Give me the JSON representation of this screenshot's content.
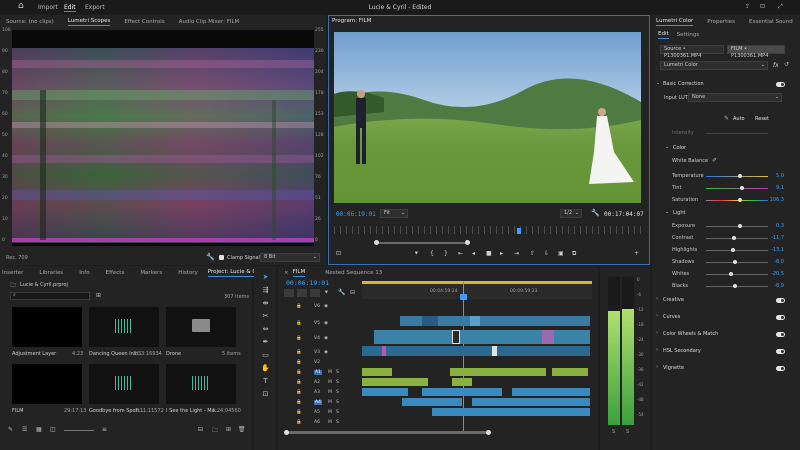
{
  "menu": {
    "home_icon": "home-icon",
    "items": [
      "Import",
      "Edit",
      "Export"
    ],
    "title": "Lucie & Cyril - Edited"
  },
  "scopes": {
    "tabs": [
      "Source: (no clips)",
      "Lumetri Scopes",
      "Effect Controls",
      "Audio Clip Mixer: FILM"
    ],
    "left_axis": [
      "100",
      "90",
      "80",
      "70",
      "60",
      "50",
      "40",
      "30",
      "20",
      "10",
      "0"
    ],
    "right_axis": [
      "255",
      "230",
      "204",
      "178",
      "153",
      "128",
      "102",
      "76",
      "51",
      "26",
      "0"
    ],
    "footer_left": "Rec. 709",
    "clamp_label": "Clamp Signal",
    "bit_depth": "8 Bit"
  },
  "program": {
    "title": "Program: FILM",
    "timecode_in": "00:06:19:01",
    "fit": "Fit",
    "resolution": "1/2",
    "timecode_out": "00:17:04:07"
  },
  "lumetri": {
    "tabs": [
      "Lumetri Color",
      "Properties",
      "Essential Sound"
    ],
    "subtabs": [
      "Edit",
      "Settings"
    ],
    "source_label": "Source • P1300361.MP4",
    "film_label": "FILM • P1300361.MP4",
    "effect_select": "Lumetri Color",
    "fx_label": "fx",
    "basic_correction": "Basic Correction",
    "input_lut_label": "Input LUT",
    "input_lut_value": "None",
    "intensity_label": "Intensity",
    "auto_label": "Auto",
    "reset_label": "Reset",
    "color_header": "Color",
    "white_balance": "White Balance",
    "color_sliders": [
      {
        "label": "Temperature",
        "value": "5,0"
      },
      {
        "label": "Tint",
        "value": "9,1"
      },
      {
        "label": "Saturation",
        "value": "106,3"
      }
    ],
    "light_header": "Light",
    "light_sliders": [
      {
        "label": "Exposure",
        "value": "0,3"
      },
      {
        "label": "Contrast",
        "value": "-11,7"
      },
      {
        "label": "Highlights",
        "value": "-13,1"
      },
      {
        "label": "Shadows",
        "value": "-8,0"
      },
      {
        "label": "Whites",
        "value": "-20,5"
      },
      {
        "label": "Blacks",
        "value": "-8,9"
      }
    ],
    "sections": [
      "Creative",
      "Curves",
      "Color Wheels & Match",
      "HSL Secondary",
      "Vignette"
    ]
  },
  "project": {
    "tabs": [
      "Inserter",
      "Libraries",
      "Info",
      "Effects",
      "Markers",
      "History",
      "Project: Lucie & Cyril"
    ],
    "file": "Lucie & Cyril.prproj",
    "item_count": "307 items",
    "items": [
      {
        "name": "Adjustment Layer",
        "meta": "4:23"
      },
      {
        "name": "Dancing Queen Inst...",
        "meta": "3:33:16934"
      },
      {
        "name": "Drone",
        "meta": "5 items"
      },
      {
        "name": "FILM",
        "meta": "29:17:13"
      },
      {
        "name": "Goodbye from Spoti...",
        "meta": "2:11:11572"
      },
      {
        "name": "I See the Light - Ma...",
        "meta": "3:24:04560"
      }
    ]
  },
  "timeline": {
    "tabs": [
      "FILM",
      "Nested Sequence 13"
    ],
    "timecode": "00:06:19:01",
    "ruler": [
      "00:04:59:24",
      "00:09:59:23"
    ],
    "video_tracks": [
      "V6",
      "V5",
      "V4",
      "V3",
      "V2",
      "V1"
    ],
    "audio_tracks": [
      "A1",
      "A2",
      "A3",
      "A4",
      "A5",
      "A6"
    ],
    "track_letters": [
      "M",
      "S"
    ]
  },
  "meter": {
    "scale": [
      "0",
      "-6",
      "-12",
      "-18",
      "-24",
      "-30",
      "-36",
      "-42",
      "-48",
      "-54"
    ],
    "labels": [
      "S",
      "S"
    ]
  }
}
